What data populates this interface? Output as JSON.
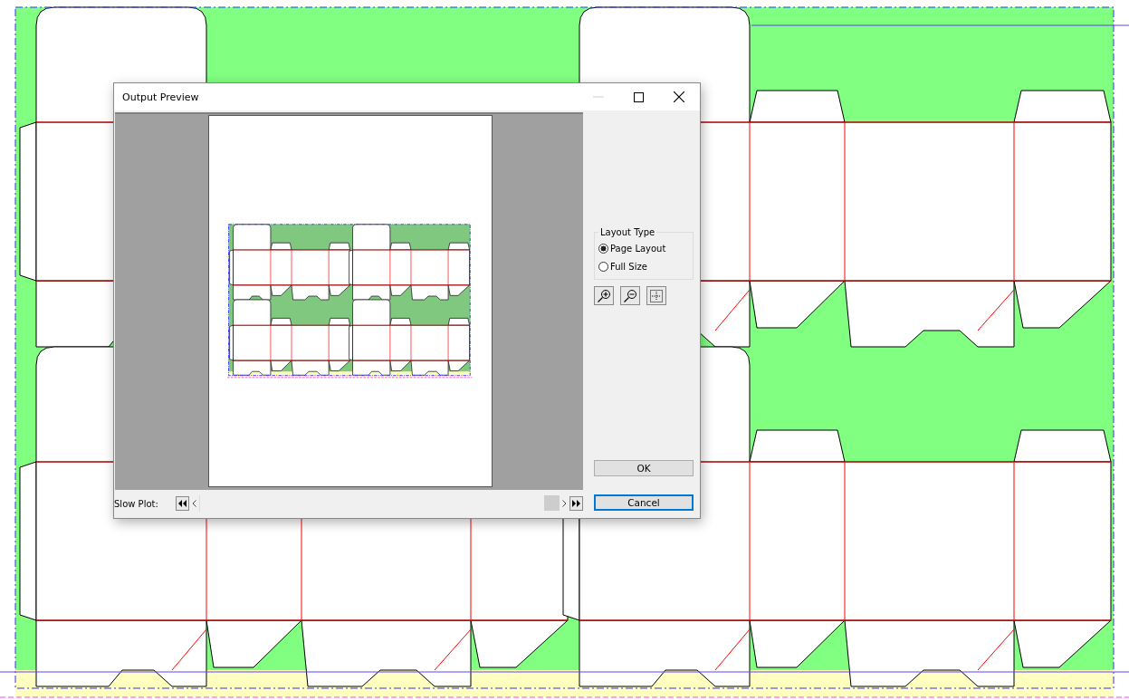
{
  "dialog": {
    "title": "Output Preview",
    "layout_type": {
      "label": "Layout Type",
      "options": [
        {
          "label": "Page Layout",
          "selected": true
        },
        {
          "label": "Full Size",
          "selected": false
        }
      ]
    },
    "buttons": [
      {
        "label": "OK",
        "default": false
      },
      {
        "label": "Cancel",
        "default": true
      }
    ],
    "slow_plot": {
      "label": "Slow Plot:"
    }
  }
}
